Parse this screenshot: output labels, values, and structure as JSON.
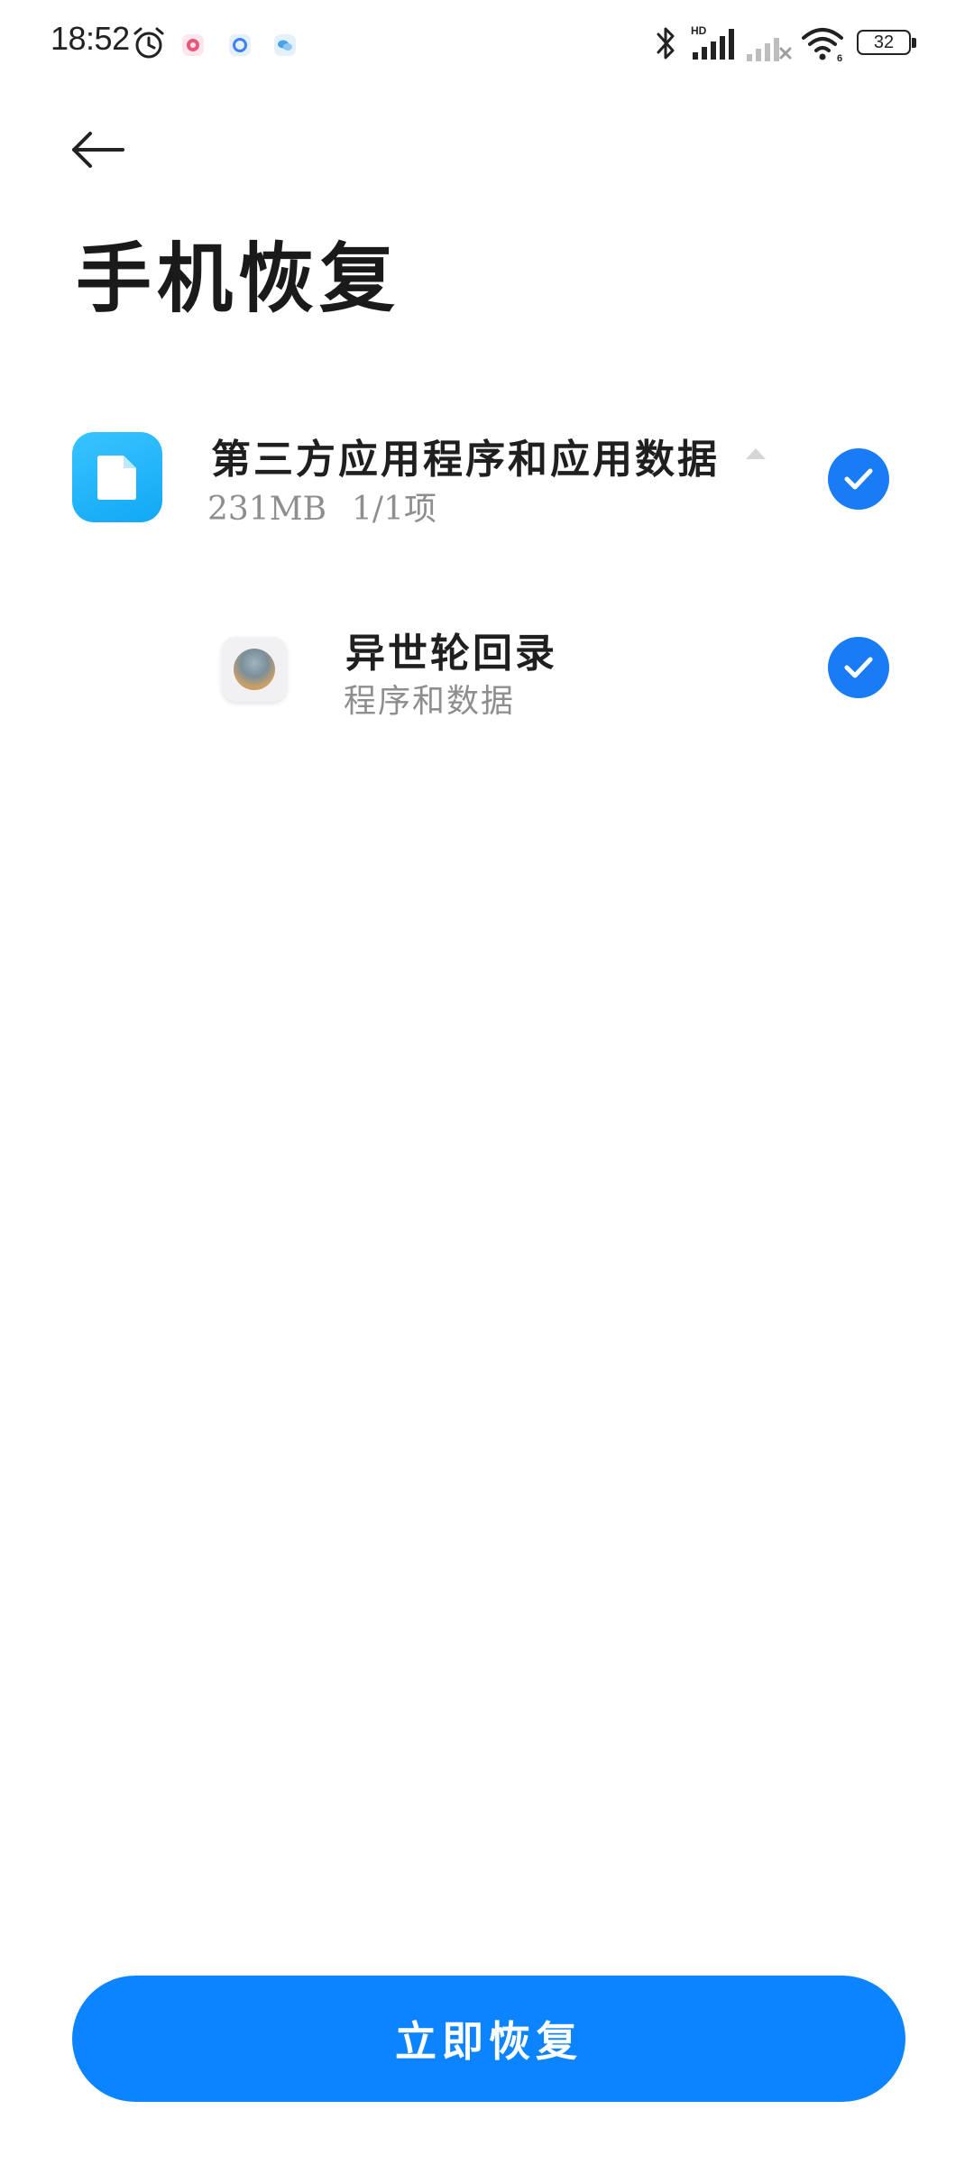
{
  "status_bar": {
    "time": "18:52",
    "battery_level": "32",
    "icons": [
      "alarm-icon",
      "notification-icon",
      "notification-icon",
      "notification-icon",
      "bluetooth-icon",
      "signal-hd-icon",
      "signal-icon",
      "wifi-icon",
      "battery-icon"
    ],
    "network_label": "HD",
    "wifi_label": "6"
  },
  "header": {
    "back_icon": "back-arrow-icon",
    "title": "手机恢复"
  },
  "category": {
    "title": "第三方应用程序和应用数据",
    "size": "231MB",
    "count": "1/1项",
    "icon": "file-icon",
    "expanded": true,
    "checked": true
  },
  "apps": [
    {
      "name": "异世轮回录",
      "description": "程序和数据",
      "checked": true
    }
  ],
  "restore_button": {
    "label": "立即恢复"
  },
  "colors": {
    "accent": "#0d84ff",
    "check": "#1a7cf5",
    "category_icon": "#22b4fa",
    "secondary_text": "#8e8e8e"
  }
}
